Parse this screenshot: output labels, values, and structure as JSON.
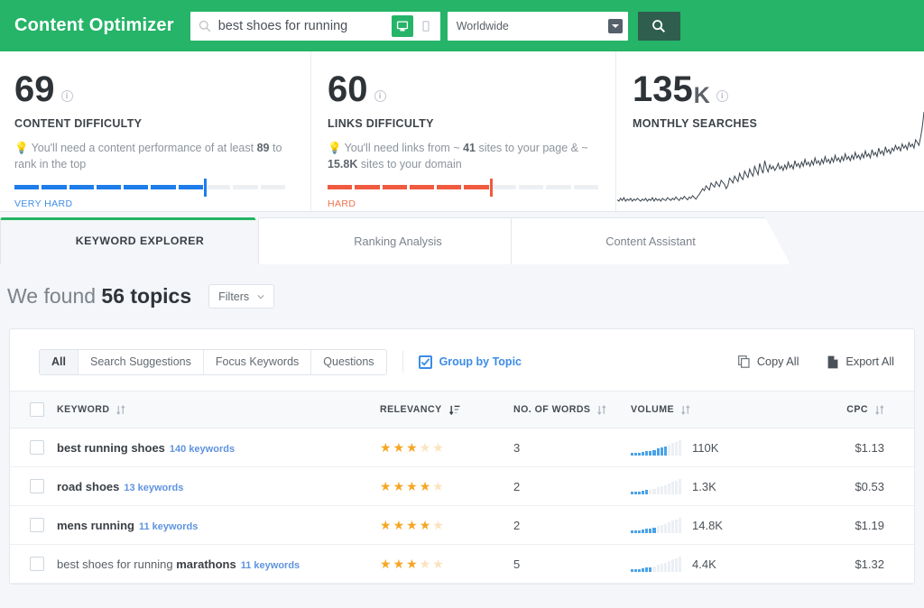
{
  "header": {
    "brand": "Content Optimizer",
    "search": {
      "icon": "search-icon",
      "value": "best shoes for running",
      "placeholder": "Enter a keyword",
      "device_desktop": "desktop-icon",
      "device_mobile": "mobile-icon"
    },
    "location": {
      "value": "Worldwide",
      "caret": "caret-down-icon"
    },
    "go_button": "search-icon",
    "colors": {
      "bar": "#25b468",
      "go_button": "#2f5d4e"
    }
  },
  "metrics": [
    {
      "value": "69",
      "suffix": "",
      "label": "CONTENT DIFFICULTY",
      "hint_pre": "You'll need a content performance of at least ",
      "hint_bold": "89",
      "hint_post": " to rank in the top",
      "caption": "VERY HARD",
      "segments_total": 10,
      "segments_filled": 7,
      "color": "#1f7dea"
    },
    {
      "value": "60",
      "suffix": "",
      "label": "LINKS DIFFICULTY",
      "hint_pre": "You'll need links from ~ ",
      "hint_bold": "41",
      "hint_mid": " sites to your page & ~ ",
      "hint_bold2": "15.8K",
      "hint_post": " sites to your domain",
      "caption": "HARD",
      "segments_total": 10,
      "segments_filled": 6,
      "color": "#f05a40"
    },
    {
      "value": "135",
      "suffix": "K",
      "label": "MONTHLY SEARCHES",
      "color": "#3a444e"
    }
  ],
  "chart_data": {
    "type": "line",
    "title": "MONTHLY SEARCHES",
    "xlabel": "",
    "ylabel": "",
    "grid": false,
    "legend": "none",
    "series": [
      {
        "name": "monthly searches",
        "values": [
          14,
          12,
          16,
          13,
          17,
          12,
          15,
          13,
          16,
          12,
          15,
          13,
          16,
          14,
          12,
          15,
          13,
          16,
          12,
          15,
          13,
          17,
          12,
          16,
          13,
          15,
          12,
          16,
          14,
          13,
          17,
          15,
          13,
          16,
          14,
          18,
          15,
          13,
          17,
          15,
          19,
          16,
          14,
          18,
          16,
          20,
          17,
          15,
          19,
          22,
          26,
          30,
          27,
          34,
          31,
          28,
          38,
          35,
          32,
          40,
          36,
          33,
          42,
          39,
          36,
          30,
          34,
          45,
          42,
          38,
          48,
          44,
          40,
          52,
          46,
          43,
          55,
          50,
          46,
          58,
          52,
          48,
          62,
          56,
          50,
          66,
          58,
          52,
          70,
          60,
          54,
          64,
          58,
          62,
          56,
          60,
          66,
          58,
          62,
          56,
          64,
          58,
          68,
          60,
          64,
          58,
          70,
          62,
          66,
          60,
          68,
          62,
          72,
          64,
          68,
          62,
          70,
          64,
          74,
          66,
          70,
          64,
          72,
          66,
          76,
          68,
          72,
          66,
          74,
          68,
          78,
          70,
          74,
          68,
          76,
          70,
          80,
          72,
          76,
          70,
          78,
          72,
          82,
          74,
          78,
          72,
          80,
          74,
          84,
          76,
          80,
          74,
          86,
          78,
          82,
          76,
          88,
          80,
          84,
          78,
          90,
          82,
          86,
          80,
          88,
          84,
          92,
          86,
          90,
          84,
          94,
          88,
          92,
          86,
          96,
          90,
          94,
          88,
          100,
          96,
          92,
          104,
          118,
          140
        ]
      }
    ],
    "line_color": "#3a444e"
  },
  "tabs": [
    {
      "label": "KEYWORD EXPLORER",
      "active": true
    },
    {
      "label": "Ranking Analysis",
      "active": false
    },
    {
      "label": "Content Assistant",
      "active": false
    }
  ],
  "results": {
    "found_prefix": "We found ",
    "found_count": "56 topics",
    "filters_label": "Filters"
  },
  "toolbar": {
    "pills": [
      {
        "label": "All",
        "active": true
      },
      {
        "label": "Search Suggestions",
        "active": false
      },
      {
        "label": "Focus Keywords",
        "active": false
      },
      {
        "label": "Questions",
        "active": false
      }
    ],
    "group_by_topic": {
      "label": "Group by Topic",
      "checked": true,
      "color": "#3b8ce8"
    },
    "copy_all": {
      "label": "Copy All",
      "icon": "copy-icon"
    },
    "export_all": {
      "label": "Export All",
      "icon": "document-icon"
    }
  },
  "table": {
    "columns": [
      {
        "label": "KEYWORD",
        "sorted": false
      },
      {
        "label": "RELEVANCY",
        "sorted": true
      },
      {
        "label": "NO. OF WORDS",
        "sorted": false
      },
      {
        "label": "VOLUME",
        "sorted": false
      },
      {
        "label": "CPC",
        "sorted": false
      }
    ],
    "rows": [
      {
        "keyword": "best running shoes",
        "keyword_prefix": "",
        "count": "140 keywords",
        "relevancy": 3,
        "relevancy_max": 5,
        "words": "3",
        "volume": "110K",
        "volume_bars_filled": 10,
        "volume_bars_total": 14,
        "cpc": "$1.13"
      },
      {
        "keyword": "road shoes",
        "keyword_prefix": "",
        "count": "13 keywords",
        "relevancy": 4,
        "relevancy_max": 5,
        "words": "2",
        "volume": "1.3K",
        "volume_bars_filled": 5,
        "volume_bars_total": 14,
        "cpc": "$0.53"
      },
      {
        "keyword": "mens running",
        "keyword_prefix": "",
        "count": "11 keywords",
        "relevancy": 4,
        "relevancy_max": 5,
        "words": "2",
        "volume": "14.8K",
        "volume_bars_filled": 7,
        "volume_bars_total": 14,
        "cpc": "$1.19"
      },
      {
        "keyword": "marathons",
        "keyword_prefix": "best shoes for running ",
        "count": "11 keywords",
        "relevancy": 3,
        "relevancy_max": 5,
        "words": "5",
        "volume": "4.4K",
        "volume_bars_filled": 6,
        "volume_bars_total": 14,
        "cpc": "$1.32"
      }
    ]
  }
}
